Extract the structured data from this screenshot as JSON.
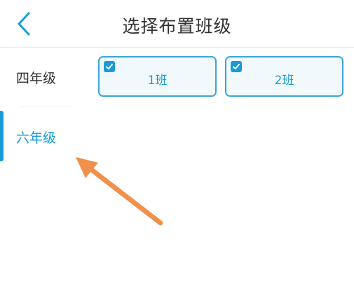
{
  "header": {
    "title": "选择布置班级",
    "back_icon": "chevron-left-icon"
  },
  "sidebar": {
    "grades": [
      {
        "label": "四年级",
        "active": false
      },
      {
        "label": "六年级",
        "active": true
      }
    ]
  },
  "classes": [
    {
      "label": "1班",
      "checked": true
    },
    {
      "label": "2班",
      "checked": true
    }
  ],
  "colors": {
    "accent": "#1b9bd6",
    "card_border": "#3aa6d8",
    "card_bg": "#f1f9fd",
    "annotation_arrow": "#f0904a"
  }
}
